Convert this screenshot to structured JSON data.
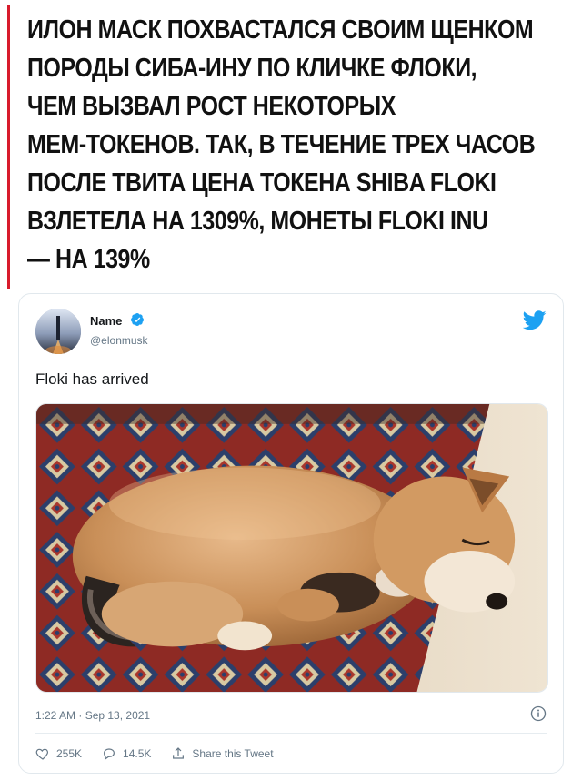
{
  "headline": {
    "lines": [
      "ИЛОН МАСК ПОХВАСТАЛСЯ СВОИМ ЩЕНКОМ",
      "ПОРОДЫ СИБА-ИНУ ПО КЛИЧКЕ ФЛОКИ,",
      "ЧЕМ ВЫЗВАЛ РОСТ НЕКОТОРЫХ",
      "МЕМ-ТОКЕНОВ. ТАК, В ТЕЧЕНИЕ ТРЕХ ЧАСОВ",
      "ПОСЛЕ ТВИТА ЦЕНА ТОКЕНА SHIBA FLOKI",
      "ВЗЛЕТЕЛА НА 1309%, МОНЕТЫ FLOKI INU",
      "— НА 139%"
    ],
    "accent_color": "#d81b2c"
  },
  "tweet": {
    "user_name": "Name",
    "handle": "@elonmusk",
    "text": "Floki has arrived",
    "timestamp": "1:22 AM · Sep 13, 2021",
    "actions": {
      "likes": "255K",
      "replies": "14.5K",
      "share_label": "Share this Tweet"
    },
    "icons": {
      "verified": "verified-badge-icon",
      "brand": "twitter-bird-icon",
      "info": "info-icon",
      "like": "heart-icon",
      "reply": "reply-icon",
      "share": "share-icon"
    },
    "colors": {
      "brand_blue": "#1da1f2",
      "secondary_text": "#657786"
    }
  }
}
